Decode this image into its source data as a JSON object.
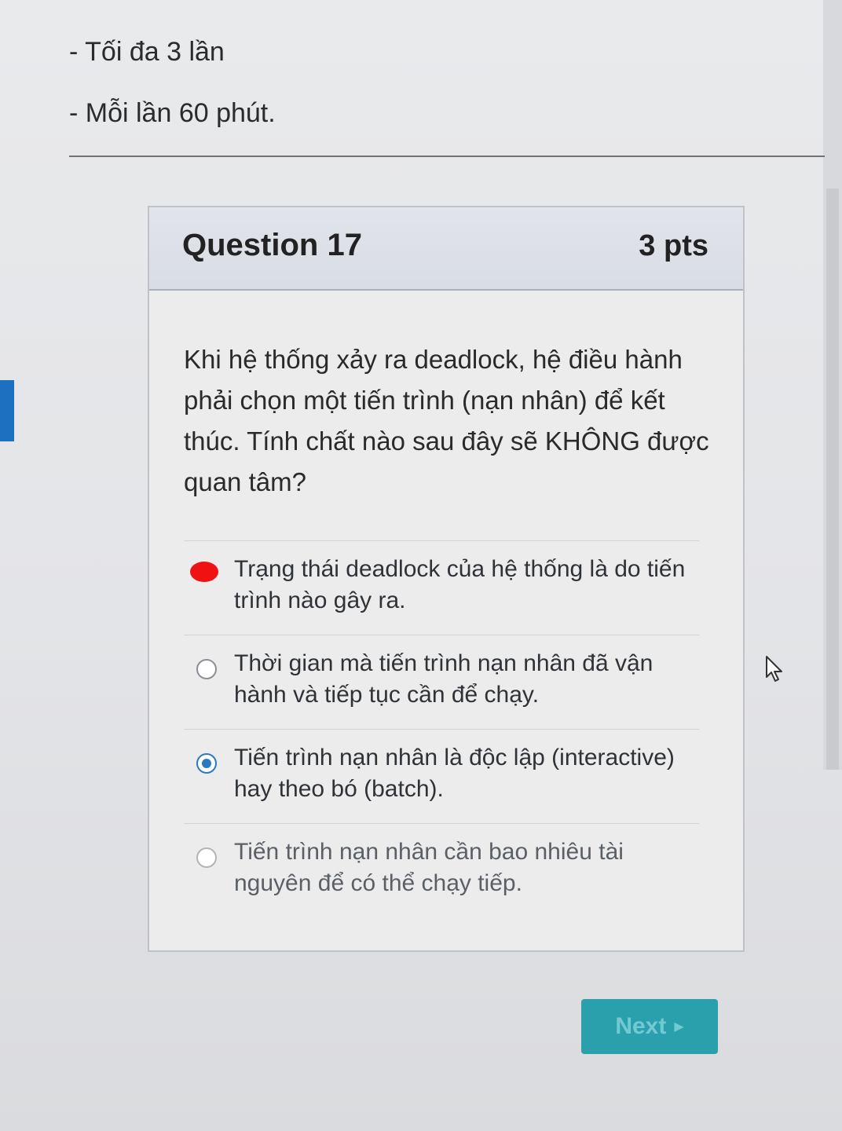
{
  "intro": {
    "lines": [
      "- Tối đa 3 lần",
      "- Mỗi lần 60 phút."
    ]
  },
  "question": {
    "title": "Question 17",
    "points": "3 pts",
    "text": "Khi hệ thống xảy ra deadlock, hệ điều hành phải chọn một tiến trình (nạn nhân) để kết thúc. Tính chất nào sau đây sẽ KHÔNG được quan tâm?",
    "answers": [
      {
        "label": "Trạng thái deadlock của hệ thống là do tiến trình nào gây ra.",
        "selected": false,
        "marked": true
      },
      {
        "label": "Thời gian mà tiến trình nạn nhân đã vận hành và tiếp tục cần để chạy.",
        "selected": false,
        "marked": false
      },
      {
        "label": "Tiến trình nạn nhân là độc lập (interactive) hay theo bó (batch).",
        "selected": true,
        "marked": false
      },
      {
        "label": "Tiến trình nạn nhân cần bao nhiêu tài nguyên để có thể chạy tiếp.",
        "selected": false,
        "marked": false
      }
    ]
  },
  "navigation": {
    "next_label": "Next",
    "next_icon": "play-arrow-icon"
  },
  "colors": {
    "accent": "#2b79c2",
    "next_button": "#2aa0ad",
    "mark": "#f01212"
  }
}
